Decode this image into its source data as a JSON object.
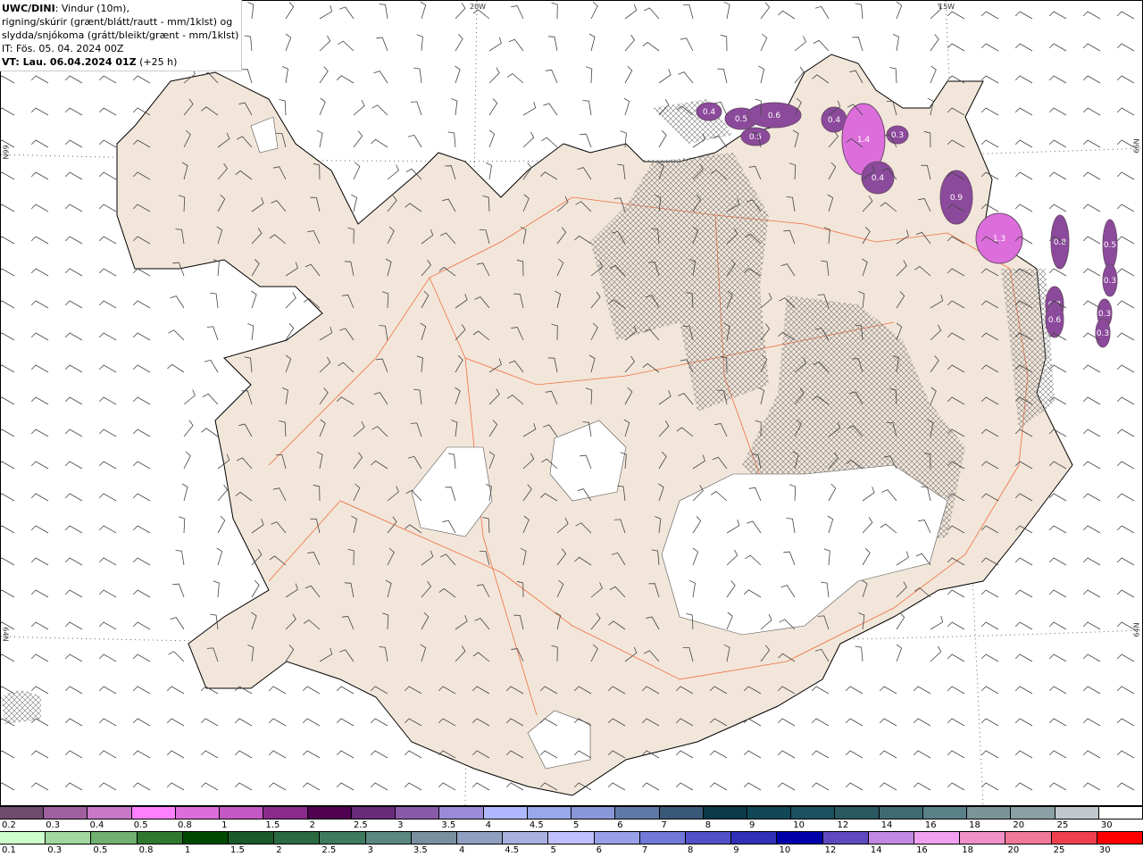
{
  "header": {
    "model": "UWC/DINI",
    "line1_rest": ": Vindur (10m),",
    "line2": "rigning/skúrir (grænt/blátt/rautt - mm/1klst) og",
    "line3": "slydda/snjókoma (grátt/bleikt/grænt - mm/1klst)",
    "it": "IT: Fös. 05. 04. 2024 00Z",
    "vt": "VT: Lau. 06.04.2024 01Z",
    "lead": "(+25 h)"
  },
  "grid_labels": {
    "lon_20w": "20W",
    "lon_15w": "15W",
    "lat_66n_left": "66N",
    "lat_66n_right": "66N",
    "lat_64n_left": "64N",
    "lat_64n_right": "64N"
  },
  "precip_labels": [
    "0.4",
    "0.5",
    "0.6",
    "0.5",
    "0.4",
    "1.4",
    "0.3",
    "0.4",
    "0.9",
    "1.3",
    "0.8",
    "0.5",
    "0.3",
    "0.7",
    "0.6",
    "0.3",
    "0.3"
  ],
  "colors": {
    "land": "#f2e6da",
    "roads": "#f07040",
    "glacier": "#ffffff",
    "snow": "#8c4a9c"
  },
  "legend_snow": {
    "labels": [
      "0.2",
      "0.3",
      "0.4",
      "0.5",
      "0.8",
      "1",
      "1.5",
      "2",
      "2.5",
      "3",
      "3.5",
      "4",
      "4.5",
      "5",
      "6",
      "7",
      "8",
      "9",
      "10",
      "12",
      "14",
      "16",
      "18",
      "20",
      "25",
      "30"
    ],
    "colors": [
      "#6e4a6e",
      "#a060a0",
      "#c878c8",
      "#ff80ff",
      "#dc6edc",
      "#c458c4",
      "#8c2a8c",
      "#500050",
      "#6a2a7a",
      "#8a5aaa",
      "#9a8ad8",
      "#b0b8ff",
      "#98a8e8",
      "#8898d8",
      "#6078a8",
      "#3a5878",
      "#0a3a48",
      "#104858",
      "#1a5060",
      "#2a5860",
      "#3e6a72",
      "#5a8088",
      "#7a9498",
      "#8aa0a4",
      "#c0c8cc",
      "#ffffff"
    ]
  },
  "legend_rain": {
    "labels": [
      "0.1",
      "0.3",
      "0.5",
      "0.8",
      "1",
      "1.5",
      "2",
      "2.5",
      "3",
      "3.5",
      "4",
      "4.5",
      "5",
      "6",
      "7",
      "8",
      "9",
      "10",
      "12",
      "14",
      "16",
      "18",
      "20",
      "25",
      "30"
    ],
    "colors": [
      "#ccffcc",
      "#a0d8a0",
      "#70b070",
      "#307830",
      "#004800",
      "#1a5a2a",
      "#2a6a40",
      "#3e7a60",
      "#5a8880",
      "#7890a0",
      "#90a0c0",
      "#a8b0e0",
      "#c0c0ff",
      "#98a0e8",
      "#7078d8",
      "#5050c8",
      "#3030b8",
      "#0000a8",
      "#6048c0",
      "#c088e0",
      "#f0a0f0",
      "#f090c8",
      "#f07898",
      "#f04050",
      "#ff0000"
    ]
  }
}
